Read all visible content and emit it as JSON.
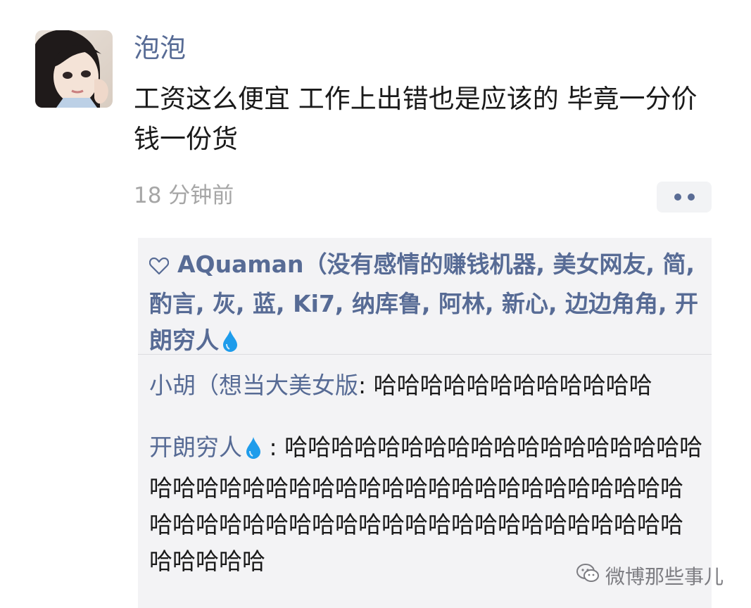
{
  "post": {
    "author": "泡泡",
    "text": "工资这么便宜 工作上出错也是应该的 毕竟一分价钱一份货",
    "time": "18 分钟前"
  },
  "likes": {
    "names": "AQuaman（没有感情的赚钱机器, 美女网友, 简, 酌言, 灰, 蓝, Ki7, 纳库鲁, 阿林, 新心, 边边角角, 开朗穷人"
  },
  "comments": [
    {
      "author": "小胡（想当大美女版",
      "separator": ": ",
      "text": "哈哈哈哈哈哈哈哈哈哈哈哈"
    },
    {
      "author": "开朗穷人",
      "separator": " : ",
      "text": "哈哈哈哈哈哈哈哈哈哈哈哈哈哈哈哈哈哈哈哈哈哈哈哈哈哈哈哈哈哈哈哈哈哈哈哈哈哈哈哈哈哈哈哈哈哈哈哈哈哈哈哈哈哈哈哈哈哈哈哈哈哈哈哈哈哈哈哈哈"
    }
  ],
  "watermark": "微博那些事儿",
  "icons": {
    "heart": "heart-icon",
    "drop": "water-drop-icon",
    "more": "more-icon",
    "watermark": "wechat-icon",
    "avatar": "avatar"
  },
  "colors": {
    "name": "#576b95",
    "time": "#a6a6a6",
    "comment_bg": "#f3f3f5",
    "drop": "#1e9ceb"
  }
}
